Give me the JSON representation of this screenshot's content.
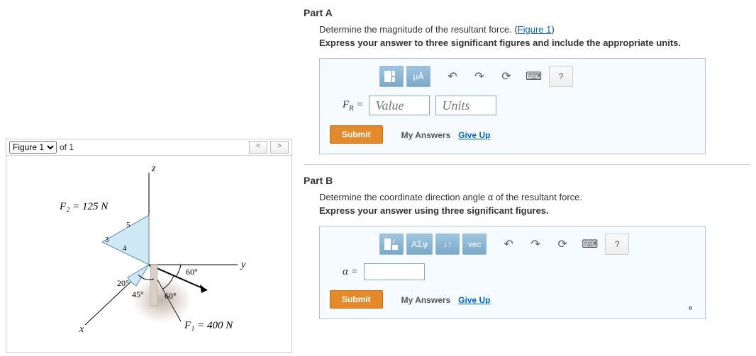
{
  "figure": {
    "selector_value": "Figure 1",
    "of_text": "of 1",
    "labels": {
      "z": "z",
      "y": "y",
      "x": "x",
      "F2": "F₂ = 125 N",
      "F1": "F₁ = 400 N",
      "a20": "20°",
      "a45": "45°",
      "a60a": "60°",
      "a60b": "60°",
      "t3": "3",
      "t4": "4",
      "t5": "5"
    }
  },
  "partA": {
    "title": "Part A",
    "prompt_text": "Determine the magnitude of the resultant force. (",
    "figure_link": "Figure 1",
    "prompt_close": ")",
    "instruction": "Express your answer to three significant figures and include the appropriate units.",
    "toolbar": {
      "t1": "µÅ",
      "help": "?"
    },
    "label_html": "F_R =",
    "value_placeholder": "Value",
    "units_placeholder": "Units",
    "submit": "Submit",
    "my_answers": "My Answers",
    "give_up": "Give Up"
  },
  "partB": {
    "title": "Part B",
    "prompt": "Determine the coordinate direction angle α of the resultant force.",
    "instruction": "Express your answer using three significant figures.",
    "toolbar": {
      "t2": "ΑΣφ",
      "t3": "↓↑",
      "t4": "vec",
      "help": "?"
    },
    "label": "α =",
    "degree": "∘",
    "submit": "Submit",
    "my_answers": "My Answers",
    "give_up": "Give Up"
  }
}
